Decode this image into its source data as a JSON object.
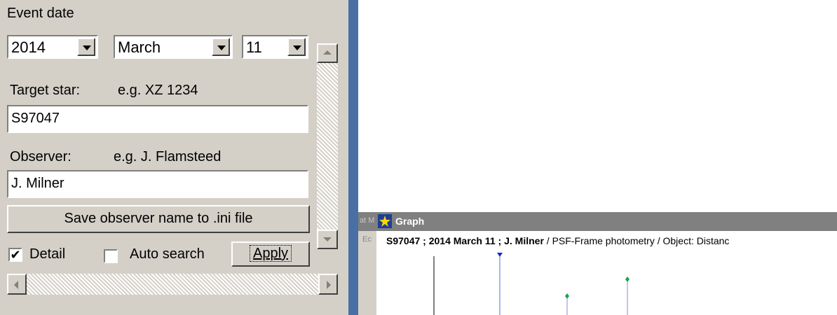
{
  "dialog": {
    "event_date_label": "Event date",
    "year": "2014",
    "month": "March",
    "day": "11",
    "target_label": "Target star:",
    "target_example": "e.g. XZ 1234",
    "target_value": "S97047",
    "observer_label": "Observer:",
    "observer_example": "e.g. J. Flamsteed",
    "observer_value": "J. Milner",
    "save_button": "Save observer name to .ini file",
    "detail_label": "Detail",
    "detail_checked": "✔",
    "auto_search_label": "Auto search",
    "apply_button": "Apply"
  },
  "graph_window": {
    "title": "Graph",
    "side_fragment_1": "at M",
    "side_fragment_2": "Ec",
    "caption_bold": "S97047 ; 2014 March 11 ; J. Milner",
    "caption_rest": " / PSF-Frame photometry /  Object: Distanc"
  }
}
